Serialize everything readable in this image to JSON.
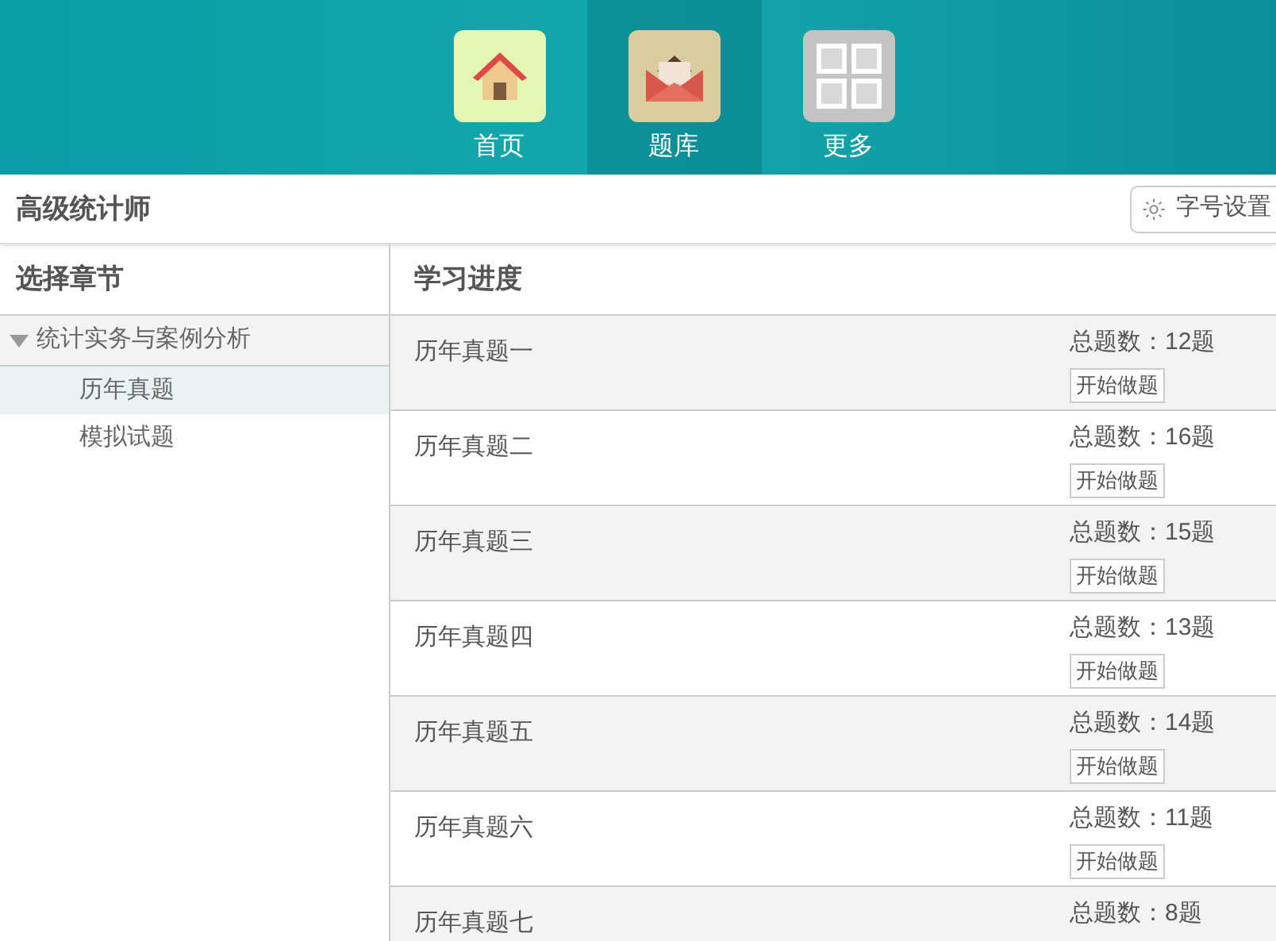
{
  "nav": [
    {
      "label": "首页",
      "kind": "home",
      "selected": false
    },
    {
      "label": "题库",
      "kind": "mail",
      "selected": true
    },
    {
      "label": "更多",
      "kind": "grid",
      "selected": false
    }
  ],
  "title": "高级统计师",
  "font_button": "字号设置",
  "sidebar": {
    "heading": "选择章节",
    "tree": [
      {
        "label": "统计实务与案例分析",
        "expanded": true,
        "children": [
          {
            "label": "历年真题",
            "selected": true
          },
          {
            "label": "模拟试题",
            "selected": false
          }
        ]
      }
    ]
  },
  "progress": {
    "heading": "学习进度",
    "rows": [
      {
        "name": "历年真题一",
        "count": "总题数：12题",
        "button": "开始做题"
      },
      {
        "name": "历年真题二",
        "count": "总题数：16题",
        "button": "开始做题"
      },
      {
        "name": "历年真题三",
        "count": "总题数：15题",
        "button": "开始做题"
      },
      {
        "name": "历年真题四",
        "count": "总题数：13题",
        "button": "开始做题"
      },
      {
        "name": "历年真题五",
        "count": "总题数：14题",
        "button": "开始做题"
      },
      {
        "name": "历年真题六",
        "count": "总题数：11题",
        "button": "开始做题"
      },
      {
        "name": "历年真题七",
        "count": "总题数：8题"
      }
    ]
  }
}
